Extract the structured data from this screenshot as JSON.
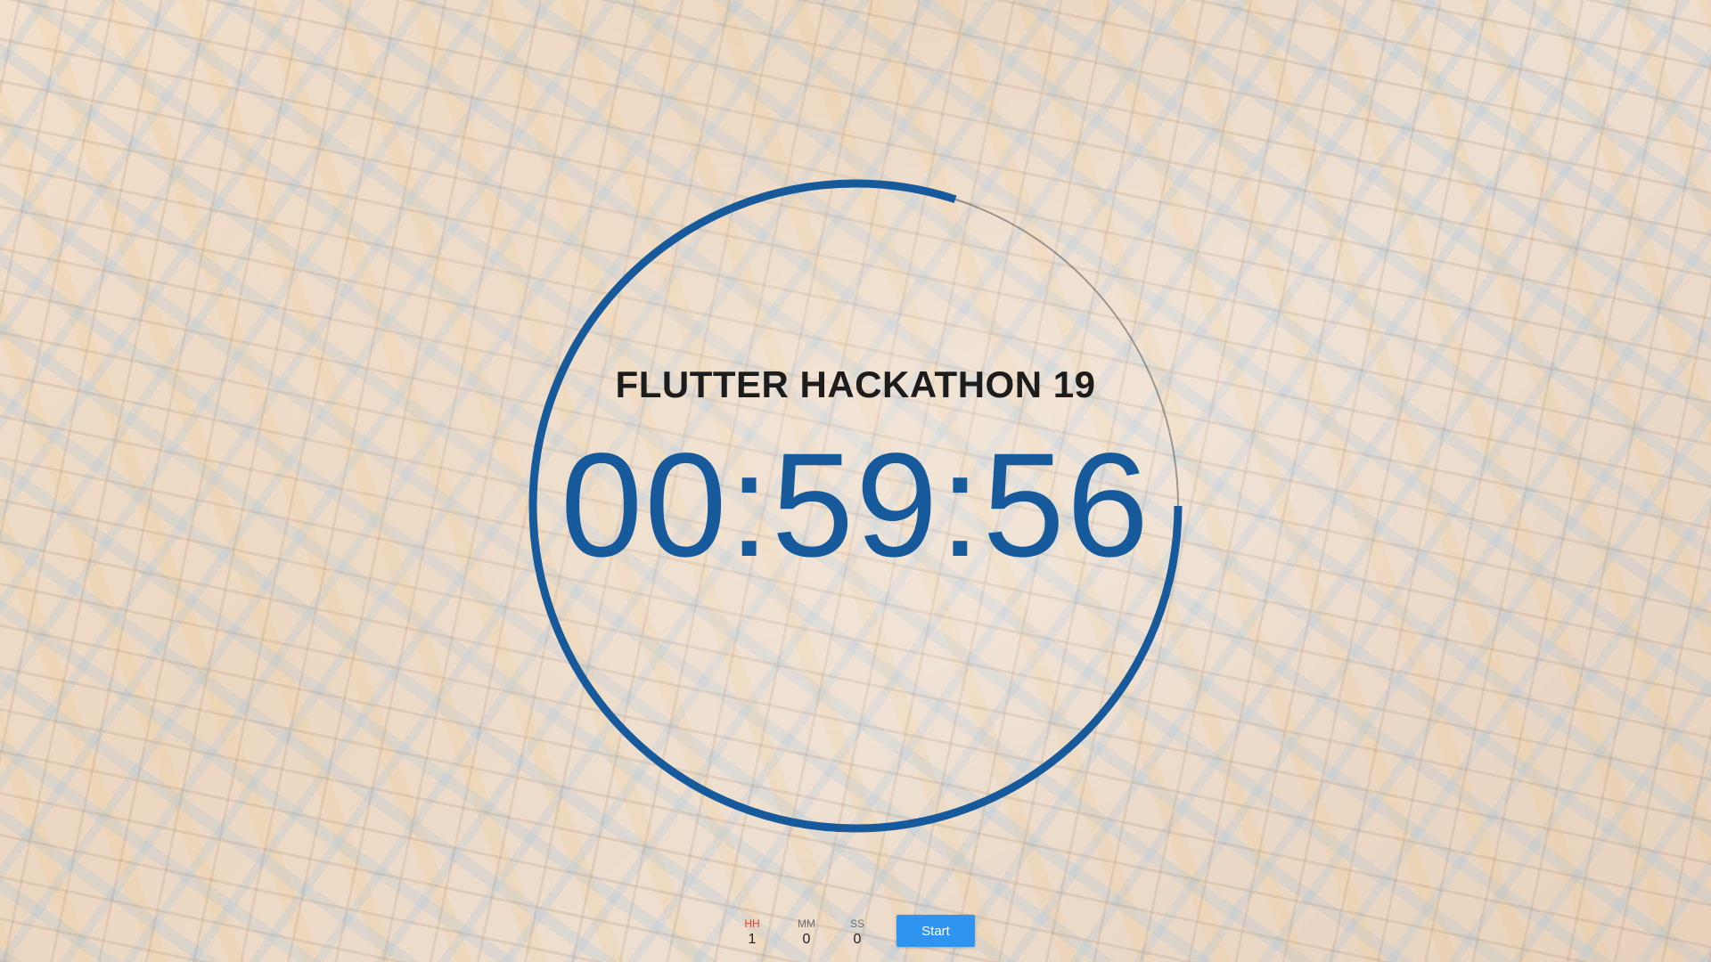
{
  "app": {
    "title": "FLUTTER HACKATHON 19",
    "countdown": "00:59:56",
    "accent_color": "#175a9c",
    "button_color": "#2f94f0",
    "ring_progress_remaining": 0.8
  },
  "inputs": {
    "hours": {
      "label": "HH",
      "value": "1"
    },
    "minutes": {
      "label": "MM",
      "value": "0"
    },
    "seconds": {
      "label": "SS",
      "value": "0"
    }
  },
  "actions": {
    "start_label": "Start"
  }
}
